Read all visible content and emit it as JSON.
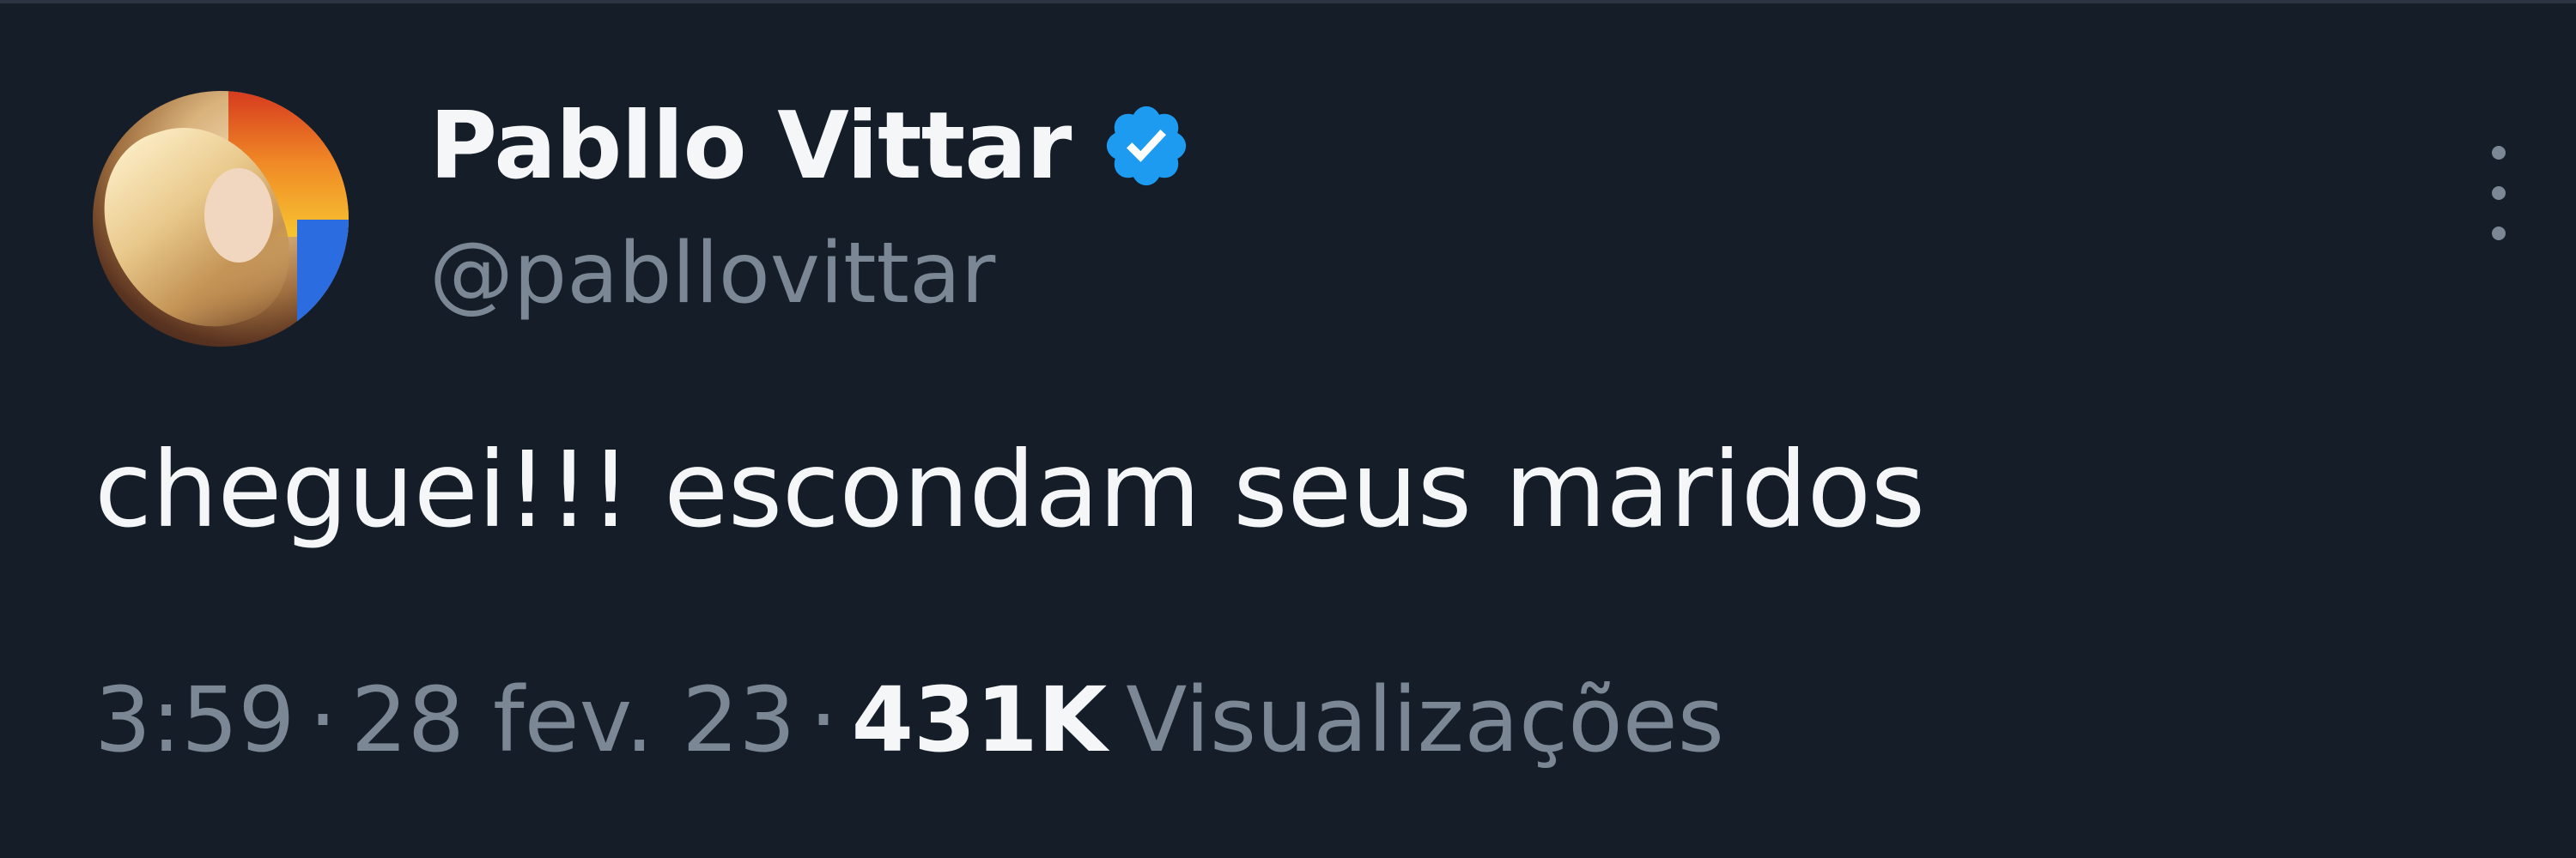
{
  "tweet": {
    "author": {
      "display_name": "Pabllo Vittar",
      "handle": "@pabllovittar",
      "verified": true,
      "verified_icon": "verified-badge-icon",
      "verified_color": "#1d9bf0"
    },
    "text": "cheguei!!! escondam seus maridos",
    "time": "3:59",
    "separator": "·",
    "date": "28 fev. 23",
    "views_count": "431K",
    "views_label": "Visualizações",
    "more_icon": "more-vertical-icon"
  },
  "colors": {
    "background": "#151d28",
    "primary_text": "#f4f6f8",
    "secondary_text": "#7b8794"
  }
}
